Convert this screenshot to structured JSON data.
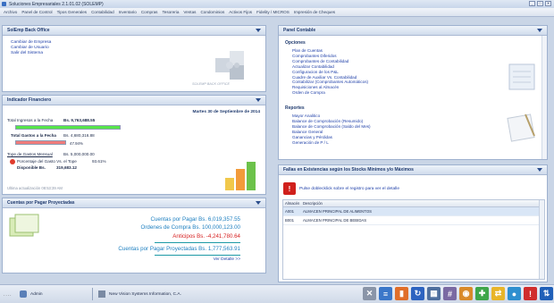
{
  "window": {
    "title": "Soluciones Empresariales 2.1.01.02 (SOLEMP)",
    "controls": [
      "_",
      "□",
      "✕"
    ]
  },
  "menu": [
    "Archivo",
    "Panel de Control",
    "Tipos Generales",
    "Contabilidad",
    "Inventario",
    "Compras",
    "Tesoreria",
    "Ventas",
    "Condominios",
    "Activos Fijos",
    "Fidelity / MICROS",
    "Impresión de Cheques"
  ],
  "backoffice": {
    "title": "SolEmp Back Office",
    "links": [
      "Cambiar de Empresa",
      "Cambiar de Usuario",
      "Salir del Sistema"
    ],
    "logo_caption": "SOLEMP BACK OFFICE"
  },
  "financiero": {
    "title": "Indicador Financiero",
    "date": "Martes 30 de Septiembre de 2014",
    "ingresos_label": "Total Ingresos a la Fecha",
    "ingresos_value": "Bs. 9,763,688.55",
    "gastos_label": "Total Gastos a la Fecha",
    "gastos_value": "Bs. 4,680,316.88",
    "gastos_pct": "47.94%",
    "gastos_fraction": 0.4794,
    "tope_label": "Tope de Gastos Mensual",
    "tope_value": "Bs. 5,000,000.00",
    "porcentaje_label": "Porcentaje del Gasto Vs. el Tope",
    "porcentaje_value": "93.61%",
    "disponible_label": "Disponible Bs.",
    "disponible_value": "319,683.12",
    "update_text": "Ultima actualización 08:53:39 AM",
    "colors": {
      "ingresos_bar": "#57e64a",
      "gastos_bar": "#f07b7b"
    }
  },
  "cuentas": {
    "title": "Cuentas por Pagar Proyectadas",
    "lines": [
      {
        "label": "Cuentas por Pagar Bs.",
        "value": "6,019,357.55",
        "color": "#1d7fc0"
      },
      {
        "label": "Ordenes de Compra Bs.",
        "value": "100,000,123.00",
        "color": "#1d7fc0"
      },
      {
        "label": "Anticipos Bs.",
        "value": "-4,241,780.64",
        "color": "#d62020"
      }
    ],
    "total_label": "Cuentas por Pagar Proyectadas Bs.",
    "total_value": "1,777,563.91",
    "detail_link": "Ver Detalle >>"
  },
  "contable": {
    "title": "Panel Contable",
    "opciones_title": "Opciones",
    "opciones": [
      "Plan de Cuentas",
      "Comprobantes Diferidos",
      "Comprobantes de Contabilidad",
      "Actualizar Contabilidad",
      "Configuracion de los P&L",
      "Cuadre de Auxiliar Vs. Contabilidad",
      "Contabilizar (Comprobantes Automáticos)",
      "Requisiciones al Almacén",
      "Orden de Compra"
    ],
    "reportes_title": "Reportes",
    "reportes": [
      "Mayor Analitico",
      "Balance de Comprobación (Resumido)",
      "Balance de Comprobación (Saldo del Mes)",
      "Balance General",
      "Ganancias y Pérdidas",
      "Generación de P / L"
    ]
  },
  "fallas": {
    "title": "Fallas en Existencias según los Stocks Mínimos y/o Máximos",
    "alert_text": "Pulse doblecklick sobre el registro para ver el detalle",
    "columns": [
      "Almacén",
      "Descripción"
    ],
    "rows": [
      {
        "code": "A001",
        "desc": "ALMACEN PRINCIPAL DE ALIMENTOS"
      },
      {
        "code": "B001",
        "desc": "ALMACEN PRINCIPAL DE BEBIDAS"
      }
    ]
  },
  "statusbar": {
    "dots": "....",
    "user": "Admin",
    "company": "New Vision Systems Information, C.A.",
    "tray_icons": [
      "tools-icon",
      "report-icon",
      "chart-icon",
      "sync-icon",
      "panel-icon",
      "calculator-icon",
      "globe-icon",
      "puzzle-icon",
      "arrows-icon",
      "users-icon",
      "warning-icon",
      "network-icon"
    ]
  }
}
